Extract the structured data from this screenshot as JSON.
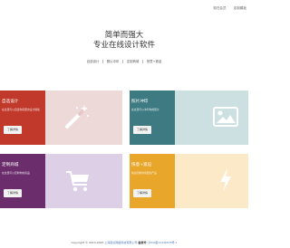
{
  "topnav": {
    "items": [
      "现在会员",
      "定制模板"
    ]
  },
  "hero": {
    "line1": "简单而强大",
    "line2": "专业在线设计软件"
  },
  "subnav": {
    "items": [
      "自选设计",
      "照片冲印",
      "定制商城",
      "快意+紧迫"
    ]
  },
  "cards": [
    {
      "title": "自选设计",
      "desc": "在这里可以自选你需要的设计模板",
      "button": "了解详情",
      "icon": "magic-wand-icon",
      "color": "#c0392b"
    },
    {
      "title": "照片冲印",
      "desc": "在这里可以冲印你的照片",
      "button": "了解详情",
      "icon": "image-icon",
      "color": "#3d7a82"
    },
    {
      "title": "定制商城",
      "desc": "在这里可以定制你的商品",
      "button": "了解详情",
      "icon": "shopping-cart-icon",
      "color": "#6b2d6b"
    },
    {
      "title": "快意+紧迫",
      "desc": "快速定制你需要的产品",
      "button": "了解详情",
      "icon": "lightning-icon",
      "color": "#e8a62a"
    }
  ],
  "footer": {
    "copyright": "Copyright © 2014-2025",
    "company": "上海起点网络科技有限公司",
    "icp_label": "备案号:",
    "icp_value": "沪ICP备12345678号-1"
  }
}
